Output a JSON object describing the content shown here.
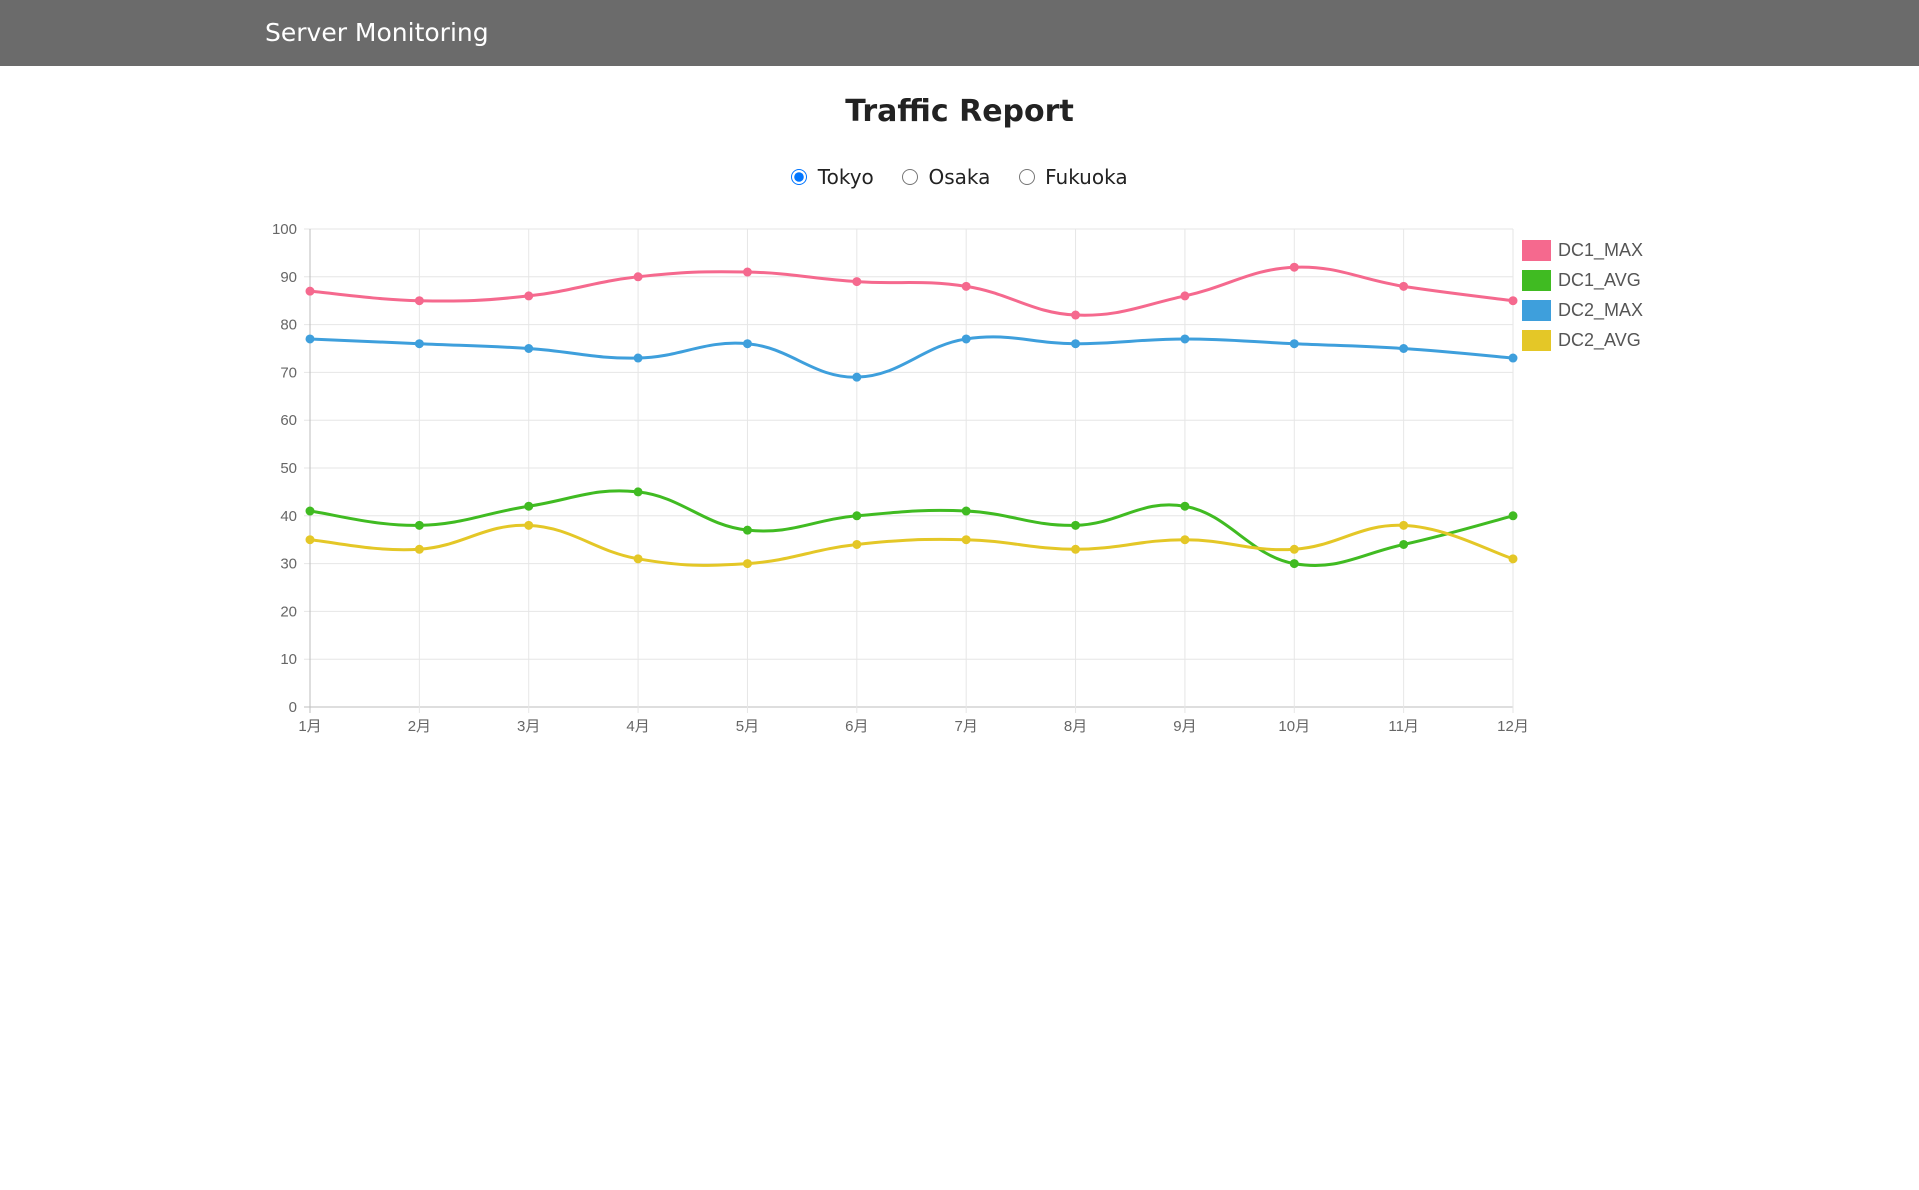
{
  "navbar": {
    "brand": "Server Monitoring"
  },
  "page": {
    "title": "Traffic Report"
  },
  "location_selector": {
    "selected": "Tokyo",
    "options": [
      "Tokyo",
      "Osaka",
      "Fukuoka"
    ]
  },
  "chart_data": {
    "type": "line",
    "title": "",
    "xlabel": "",
    "ylabel": "",
    "categories": [
      "1月",
      "2月",
      "3月",
      "4月",
      "5月",
      "6月",
      "7月",
      "8月",
      "9月",
      "10月",
      "11月",
      "12月"
    ],
    "ylim": [
      0,
      100
    ],
    "yticks": [
      0,
      10,
      20,
      30,
      40,
      50,
      60,
      70,
      80,
      90,
      100
    ],
    "grid": true,
    "legend_position": "right",
    "series": [
      {
        "name": "DC1_MAX",
        "color": "#f5698e",
        "values": [
          87,
          85,
          86,
          90,
          91,
          89,
          88,
          82,
          86,
          92,
          88,
          85
        ]
      },
      {
        "name": "DC1_AVG",
        "color": "#40bb22",
        "values": [
          41,
          38,
          42,
          45,
          37,
          40,
          41,
          38,
          42,
          30,
          34,
          40
        ]
      },
      {
        "name": "DC2_MAX",
        "color": "#3e9fdc",
        "values": [
          77,
          76,
          75,
          73,
          76,
          69,
          77,
          76,
          77,
          76,
          75,
          73
        ]
      },
      {
        "name": "DC2_AVG",
        "color": "#e4c727",
        "values": [
          35,
          33,
          38,
          31,
          30,
          34,
          35,
          33,
          35,
          33,
          38,
          31
        ]
      }
    ]
  }
}
